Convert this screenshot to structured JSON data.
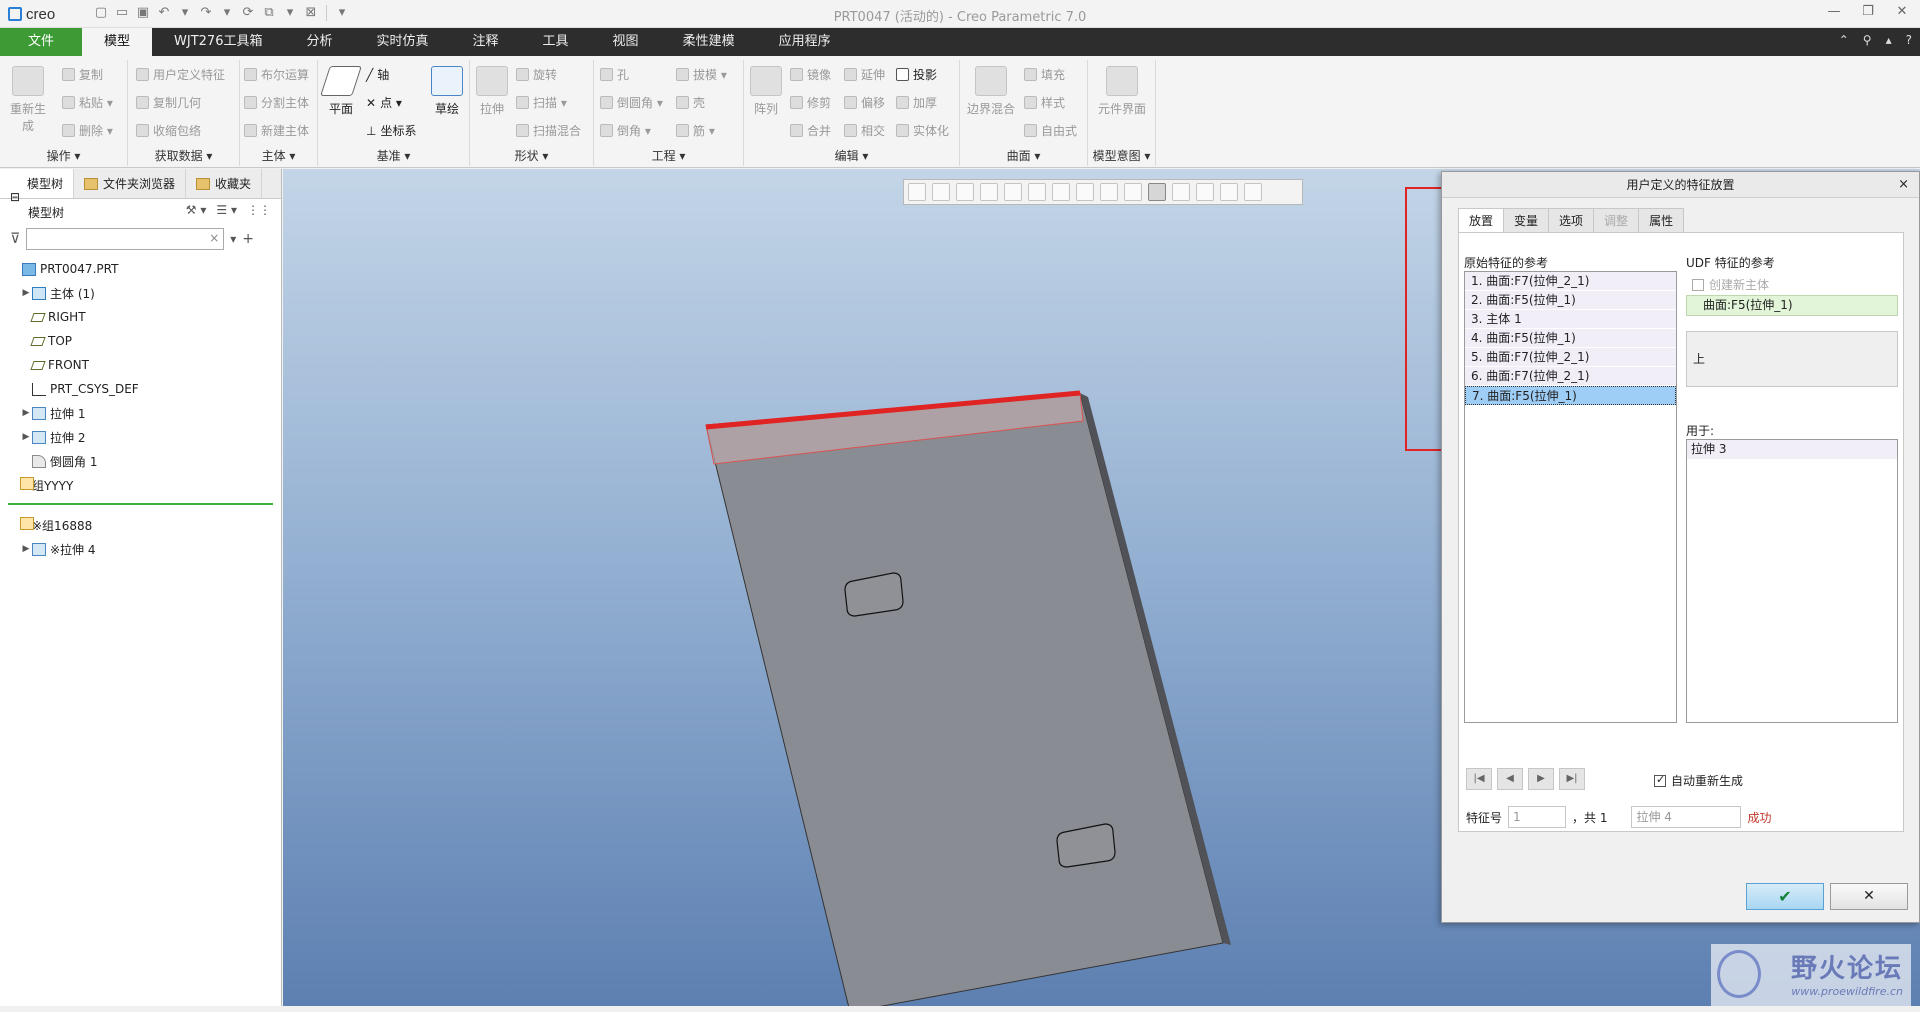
{
  "app": {
    "logo": "creo",
    "window_title": "PRT0047 (活动的) - Creo Parametric 7.0"
  },
  "colors": {
    "file_tab": "#3e9a35",
    "ribbon_bar": "#2d2d2d",
    "highlight_red": "#e02424",
    "selection_blue": "#9ecdf5",
    "success_red": "#c0392b"
  },
  "ribbon_tabs": [
    "文件",
    "模型",
    "WJT276工具箱",
    "分析",
    "实时仿真",
    "注释",
    "工具",
    "视图",
    "柔性建模",
    "应用程序"
  ],
  "ribbon": {
    "ops": {
      "label": "操作 ▾",
      "regen": "重新生成",
      "copy": "复制",
      "paste": "粘贴 ▾",
      "delete": "删除 ▾"
    },
    "getdata": {
      "label": "获取数据 ▾",
      "udf": "用户定义特征",
      "copy_geom": "复制几何",
      "shrinkwrap": "收缩包络"
    },
    "body": {
      "label": "主体 ▾",
      "boolean": "布尔运算",
      "split": "分割主体",
      "new": "新建主体"
    },
    "datum": {
      "label": "基准 ▾",
      "plane": "平面",
      "axis": "轴",
      "point": "点 ▾",
      "csys": "坐标系",
      "sketch": "草绘"
    },
    "shapes": {
      "label": "形状 ▾",
      "extrude": "拉伸",
      "revolve": "旋转",
      "sweep": "扫描 ▾",
      "swept_blend": "扫描混合"
    },
    "engineering": {
      "label": "工程 ▾",
      "hole": "孔",
      "round": "倒圆角 ▾",
      "chamfer": "倒角 ▾",
      "draft": "拔模 ▾",
      "shell": "壳",
      "rib": "筋 ▾"
    },
    "editing": {
      "label": "编辑 ▾",
      "pattern": "阵列",
      "mirror": "镜像",
      "extend": "延伸",
      "project": "投影",
      "trim": "修剪",
      "offset": "偏移",
      "thicken": "加厚",
      "merge": "合并",
      "intersect": "相交",
      "solidify": "实体化"
    },
    "surfaces": {
      "label": "曲面 ▾",
      "boundary": "边界混合",
      "fill": "填充",
      "style": "样式",
      "freestyle": "自由式"
    },
    "intent": {
      "label": "模型意图 ▾",
      "component_interface": "元件界面"
    }
  },
  "left_panel": {
    "tabs": [
      "模型树",
      "文件夹浏览器",
      "收藏夹"
    ],
    "header": "模型树",
    "tree": [
      {
        "label": "PRT0047.PRT",
        "icon": "part-icon",
        "expander": "",
        "indent": 0
      },
      {
        "label": "主体 (1)",
        "icon": "body-icon",
        "expander": "▶",
        "indent": 1
      },
      {
        "label": "RIGHT",
        "icon": "plane-icon",
        "expander": "",
        "indent": 1
      },
      {
        "label": "TOP",
        "icon": "plane-icon",
        "expander": "",
        "indent": 1
      },
      {
        "label": "FRONT",
        "icon": "plane-icon",
        "expander": "",
        "indent": 1
      },
      {
        "label": "PRT_CSYS_DEF",
        "icon": "csys-icon",
        "expander": "",
        "indent": 1
      },
      {
        "label": "拉伸 1",
        "icon": "extrude-icon",
        "expander": "▶",
        "indent": 1
      },
      {
        "label": "拉伸 2",
        "icon": "extrude-icon",
        "expander": "▶",
        "indent": 1
      },
      {
        "label": "倒圆角 1",
        "icon": "round-icon",
        "expander": "",
        "indent": 1
      },
      {
        "label": "组YYYY",
        "icon": "group-icon",
        "expander": "▶",
        "indent": 1
      }
    ],
    "tree_after": [
      {
        "label": "※组16888",
        "icon": "group-icon",
        "expander": "▶"
      },
      {
        "label": "※拉伸 4",
        "icon": "extrude-icon",
        "expander": "▶"
      }
    ]
  },
  "dialog": {
    "title": "用户定义的特征放置",
    "close": "×",
    "tabs": [
      "放置",
      "变量",
      "选项",
      "调整",
      "属性"
    ],
    "orig_refs_label": "原始特征的参考",
    "orig_refs": [
      "1. 曲面:F7(拉伸_2_1)",
      "2. 曲面:F5(拉伸_1)",
      "3. 主体 1",
      "4. 曲面:F5(拉伸_1)",
      "5. 曲面:F7(拉伸_2_1)",
      "6. 曲面:F7(拉伸_2_1)",
      "7. 曲面:F5(拉伸_1)"
    ],
    "selected_index": 6,
    "udf_refs_label": "UDF 特征的参考",
    "create_new_body": "创建新主体",
    "udf_ref_value": "曲面:F5(拉伸_1)",
    "direction": "上",
    "used_for_label": "用于:",
    "used_for": [
      "拉伸 3"
    ],
    "auto_regen": "自动重新生成",
    "feature_no_label": "特征号",
    "feature_no_value": "1",
    "of_total": "，共 1",
    "feature_name": "拉伸 4",
    "status": "成功",
    "ok": "✔",
    "cancel": "✕"
  },
  "watermark": {
    "title": "野火论坛",
    "url": "www.proewildfire.cn"
  }
}
